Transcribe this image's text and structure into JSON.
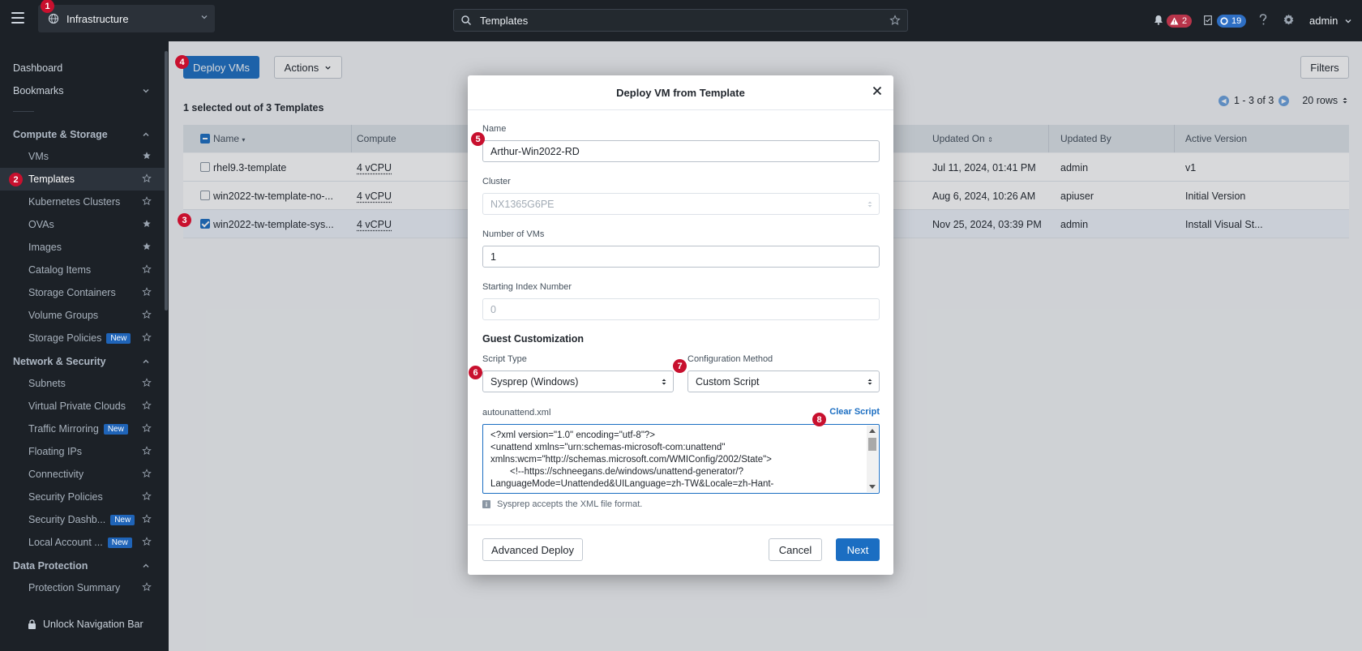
{
  "topbar": {
    "app_name": "Infrastructure",
    "search_value": "Templates",
    "alerts_count": "2",
    "tasks_count": "19",
    "user": "admin"
  },
  "annotations": [
    "1",
    "2",
    "3",
    "4",
    "5",
    "6",
    "7",
    "8"
  ],
  "sidebar": {
    "dashboard": "Dashboard",
    "bookmarks": "Bookmarks",
    "groups": {
      "compute": "Compute & Storage",
      "network": "Network & Security",
      "data": "Data Protection"
    },
    "items": [
      {
        "label": "VMs",
        "tag": ""
      },
      {
        "label": "Templates",
        "tag": ""
      },
      {
        "label": "Kubernetes Clusters",
        "tag": ""
      },
      {
        "label": "OVAs",
        "tag": ""
      },
      {
        "label": "Images",
        "tag": ""
      },
      {
        "label": "Catalog Items",
        "tag": ""
      },
      {
        "label": "Storage Containers",
        "tag": ""
      },
      {
        "label": "Volume Groups",
        "tag": ""
      },
      {
        "label": "Storage Policies",
        "tag": "New"
      },
      {
        "label": "Subnets",
        "tag": ""
      },
      {
        "label": "Virtual Private Clouds",
        "tag": ""
      },
      {
        "label": "Traffic Mirroring",
        "tag": "New"
      },
      {
        "label": "Floating IPs",
        "tag": ""
      },
      {
        "label": "Connectivity",
        "tag": ""
      },
      {
        "label": "Security Policies",
        "tag": ""
      },
      {
        "label": "Security Dashb...",
        "tag": "New"
      },
      {
        "label": "Local Account ...",
        "tag": "New"
      },
      {
        "label": "Protection Summary",
        "tag": ""
      }
    ],
    "unlock": "Unlock Navigation Bar"
  },
  "main": {
    "deploy_button": "Deploy VMs",
    "actions_button": "Actions",
    "filters_button": "Filters",
    "selection_text": "1 selected out of 3 Templates",
    "pager_text": "1 - 3 of 3",
    "rows_text": "20 rows",
    "columns": [
      "Name",
      "Compute",
      "Updated On",
      "Updated By",
      "Active Version"
    ],
    "rows": [
      {
        "name": "rhel9.3-template",
        "compute": "4 vCPU",
        "updated_on": "Jul 11, 2024, 01:41 PM",
        "updated_by": "admin",
        "version": "v1"
      },
      {
        "name": "win2022-tw-template-no-...",
        "compute": "4 vCPU",
        "updated_on": "Aug 6, 2024, 10:26 AM",
        "updated_by": "apiuser",
        "version": "Initial Version"
      },
      {
        "name": "win2022-tw-template-sys...",
        "compute": "4 vCPU",
        "updated_on": "Nov 25, 2024, 03:39 PM",
        "updated_by": "admin",
        "version": "Install Visual St..."
      }
    ]
  },
  "modal": {
    "title": "Deploy VM from Template",
    "name_label": "Name",
    "name_value": "Arthur-Win2022-RD",
    "cluster_label": "Cluster",
    "cluster_value": "NX1365G6PE",
    "num_vms_label": "Number of VMs",
    "num_vms_value": "1",
    "start_index_label": "Starting Index Number",
    "start_index_placeholder": "0",
    "guest_title": "Guest Customization",
    "script_type_label": "Script Type",
    "script_type_value": "Sysprep (Windows)",
    "config_method_label": "Configuration Method",
    "config_method_value": "Custom Script",
    "file_label": "autounattend.xml",
    "clear_script": "Clear Script",
    "script_lines": [
      "<?xml version=\"1.0\" encoding=\"utf-8\"?>",
      "<unattend xmlns=\"urn:schemas-microsoft-com:unattend\"",
      "xmlns:wcm=\"http://schemas.microsoft.com/WMIConfig/2002/State\">",
      "<!--https://schneegans.de/windows/unattend-generator/?",
      "LanguageMode=Unattended&UILanguage=zh-TW&Locale=zh-Hant-"
    ],
    "help_text": "Sysprep accepts the XML file format.",
    "advanced_button": "Advanced Deploy",
    "cancel_button": "Cancel",
    "next_button": "Next"
  }
}
